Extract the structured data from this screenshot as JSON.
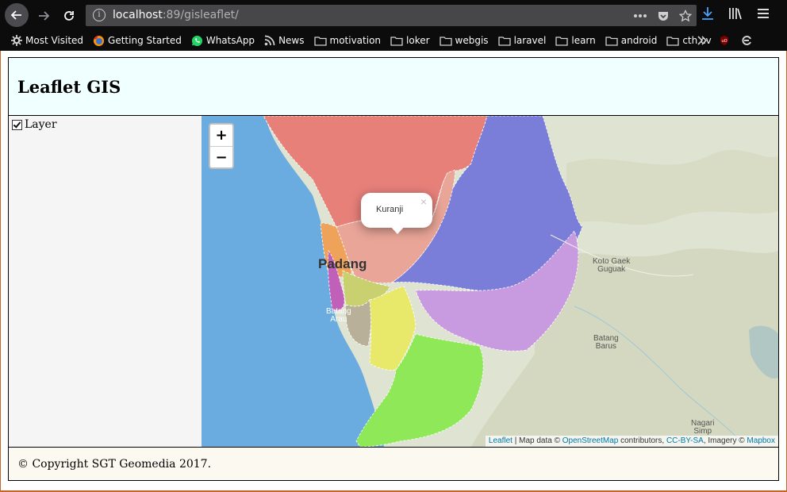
{
  "browser": {
    "url_host": "localhost",
    "url_path": ":89/gisleaflet/",
    "bookmarks": [
      {
        "label": "Most Visited",
        "icon": "gear-icon"
      },
      {
        "label": "Getting Started",
        "icon": "firefox-icon"
      },
      {
        "label": "WhatsApp",
        "icon": "whatsapp-icon"
      },
      {
        "label": "News",
        "icon": "rss-icon"
      },
      {
        "label": "motivation",
        "icon": "folder-icon"
      },
      {
        "label": "loker",
        "icon": "folder-icon"
      },
      {
        "label": "webgis",
        "icon": "folder-icon"
      },
      {
        "label": "laravel",
        "icon": "folder-icon"
      },
      {
        "label": "learn",
        "icon": "folder-icon"
      },
      {
        "label": "android",
        "icon": "folder-icon"
      },
      {
        "label": "cth cv",
        "icon": "folder-icon"
      }
    ]
  },
  "page": {
    "title": "Leaflet GIS",
    "sidebar": {
      "layer_label": "Layer",
      "layer_checked": true
    },
    "footer": "© Copyright SGT Geomedia 2017."
  },
  "map": {
    "zoom_in": "+",
    "zoom_out": "−",
    "popup": {
      "text": "Kuranji",
      "close": "×"
    },
    "labels": {
      "padang": "Padang",
      "koto_gaek_1": "Koto Gaek",
      "koto_gaek_2": "Guguak",
      "batang_arau_1": "Batang",
      "batang_arau_2": "Arau",
      "batang_barus_1": "Batang",
      "batang_barus_2": "Barus",
      "nagari_1": "Nagari",
      "nagari_2": "Simp"
    },
    "attribution": {
      "leaflet": "Leaflet",
      "sep1": " | Map data © ",
      "osm": "OpenStreetMap",
      "sep2": " contributors, ",
      "license": "CC-BY-SA",
      "sep3": ", Imagery © ",
      "mapbox": "Mapbox"
    },
    "colors": {
      "sea": "#6aace0",
      "land": "#d9dcc4",
      "red": "#e8807a",
      "blue": "#7a7ed8",
      "orange": "#eea25a",
      "salmon": "#e9a597",
      "purple": "#c89ae0",
      "magenta": "#c060b8",
      "olive": "#c8d070",
      "yellow": "#e8e86a",
      "green": "#8ee858",
      "gray": "#b8b098"
    }
  }
}
